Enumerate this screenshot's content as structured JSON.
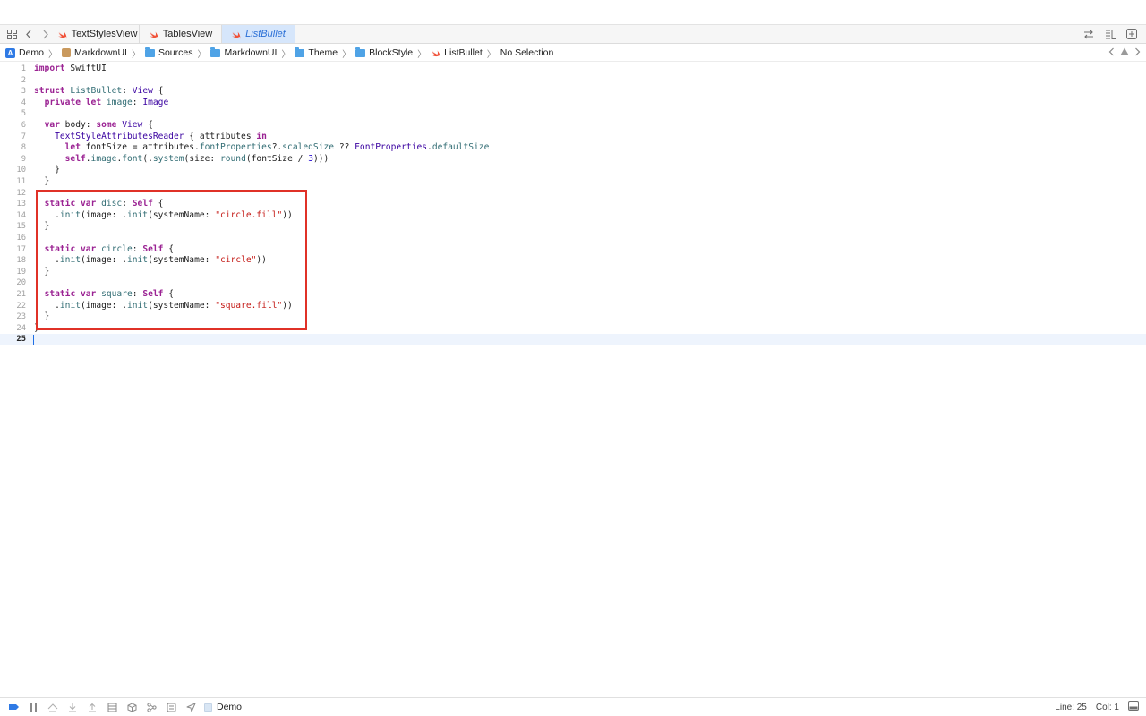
{
  "tabs": [
    {
      "label": "TextStylesView",
      "active": false
    },
    {
      "label": "TablesView",
      "active": false
    },
    {
      "label": "ListBullet",
      "active": true
    }
  ],
  "breadcrumb": [
    "Demo",
    "MarkdownUI",
    "Sources",
    "MarkdownUI",
    "Theme",
    "BlockStyle",
    "ListBullet",
    "No Selection"
  ],
  "editor": {
    "lines": [
      {
        "n": "1"
      },
      {
        "n": "2"
      },
      {
        "n": "3"
      },
      {
        "n": "4"
      },
      {
        "n": "5"
      },
      {
        "n": "6"
      },
      {
        "n": "7"
      },
      {
        "n": "8"
      },
      {
        "n": "9"
      },
      {
        "n": "10"
      },
      {
        "n": "11"
      },
      {
        "n": "12"
      },
      {
        "n": "13"
      },
      {
        "n": "14"
      },
      {
        "n": "15"
      },
      {
        "n": "16"
      },
      {
        "n": "17"
      },
      {
        "n": "18"
      },
      {
        "n": "19"
      },
      {
        "n": "20"
      },
      {
        "n": "21"
      },
      {
        "n": "22"
      },
      {
        "n": "23"
      },
      {
        "n": "24"
      },
      {
        "n": "25"
      }
    ],
    "tokens": {
      "l1": [
        "import",
        " SwiftUI"
      ],
      "l3": [
        "struct",
        " ListBullet",
        ": ",
        "View",
        " {"
      ],
      "l4": [
        "  ",
        "private",
        " ",
        "let",
        " ",
        "image",
        ": ",
        "Image"
      ],
      "l6": [
        "  ",
        "var",
        " body: ",
        "some",
        " ",
        "View",
        " {"
      ],
      "l7": [
        "    ",
        "TextStyleAttributesReader",
        " { attributes ",
        "in"
      ],
      "l8": [
        "      ",
        "let",
        " fontSize = attributes.",
        "fontProperties",
        "?.",
        "scaledSize",
        " ?? ",
        "FontProperties",
        ".",
        "defaultSize"
      ],
      "l9": [
        "      ",
        "self",
        ".",
        "image",
        ".",
        "font",
        "(.",
        "system",
        "(size: ",
        "round",
        "(fontSize / ",
        "3",
        ")))"
      ],
      "l10": [
        "    }"
      ],
      "l11": [
        "  }"
      ],
      "l13": [
        "  ",
        "static",
        " ",
        "var",
        " ",
        "disc",
        ": ",
        "Self",
        " {"
      ],
      "l14": [
        "    .",
        "init",
        "(image: .",
        "init",
        "(systemName: ",
        "\"circle.fill\"",
        "))"
      ],
      "l15": [
        "  }"
      ],
      "l17": [
        "  ",
        "static",
        " ",
        "var",
        " ",
        "circle",
        ": ",
        "Self",
        " {"
      ],
      "l18": [
        "    .",
        "init",
        "(image: .",
        "init",
        "(systemName: ",
        "\"circle\"",
        "))"
      ],
      "l19": [
        "  }"
      ],
      "l21": [
        "  ",
        "static",
        " ",
        "var",
        " ",
        "square",
        ": ",
        "Self",
        " {"
      ],
      "l22": [
        "    .",
        "init",
        "(image: .",
        "init",
        "(systemName: ",
        "\"square.fill\"",
        "))"
      ],
      "l23": [
        "  }"
      ],
      "l24": [
        "}"
      ]
    }
  },
  "statusbar": {
    "scheme": "Demo",
    "line": "Line: 25",
    "col": "Col: 1"
  },
  "colors": {
    "keyword": "#9b2393",
    "type": "#3900a0",
    "property": "#326d74",
    "string": "#c41a16",
    "number": "#1c00cf",
    "highlight_box": "#e03127",
    "active_tab": "#d6e6fb"
  }
}
